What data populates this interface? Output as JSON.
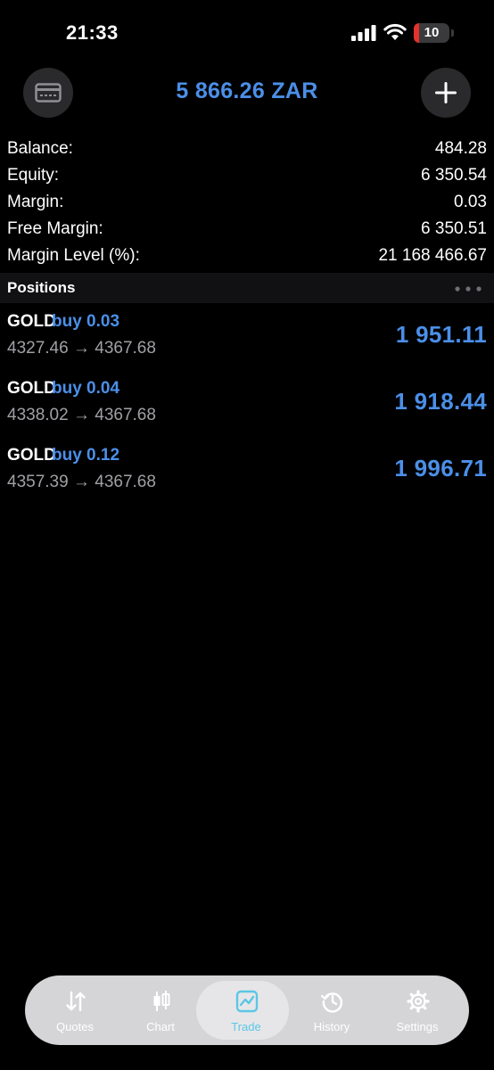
{
  "status_bar": {
    "time": "21:33",
    "battery_level": "10",
    "icons": [
      "signal-icon",
      "wifi-icon",
      "battery-icon"
    ]
  },
  "header": {
    "total": "5 866.26 ZAR",
    "left_icon": "card-icon",
    "right_icon": "plus-icon"
  },
  "summary": {
    "rows": [
      {
        "label": "Balance:",
        "value": "484.28"
      },
      {
        "label": "Equity:",
        "value": "6 350.54"
      },
      {
        "label": "Margin:",
        "value": "0.03"
      },
      {
        "label": "Free Margin:",
        "value": "6 350.51"
      },
      {
        "label": "Margin Level (%):",
        "value": "21 168 466.67"
      }
    ]
  },
  "positions": {
    "title": "Positions",
    "items": [
      {
        "symbol": "GOLD",
        "side": "buy 0.03",
        "open_price": "4327.46",
        "arrow": "→",
        "current_price": "4367.68",
        "profit": "1 951.11"
      },
      {
        "symbol": "GOLD",
        "side": "buy 0.04",
        "open_price": "4338.02",
        "arrow": "→",
        "current_price": "4367.68",
        "profit": "1 918.44"
      },
      {
        "symbol": "GOLD",
        "side": "buy 0.12",
        "open_price": "4357.39",
        "arrow": "→",
        "current_price": "4367.68",
        "profit": "1 996.71"
      }
    ]
  },
  "tabs": [
    {
      "label": "Quotes",
      "icon": "quotes-arrows-icon"
    },
    {
      "label": "Chart",
      "icon": "candlestick-icon"
    },
    {
      "label": "Trade",
      "icon": "trade-chart-icon",
      "active": true
    },
    {
      "label": "History",
      "icon": "history-clock-icon"
    },
    {
      "label": "Settings",
      "icon": "gear-icon"
    }
  ],
  "colors": {
    "accent": "#4b8fe8",
    "active_tab": "#5bc7e4",
    "background": "#000000",
    "battery_low": "#e5322d"
  }
}
